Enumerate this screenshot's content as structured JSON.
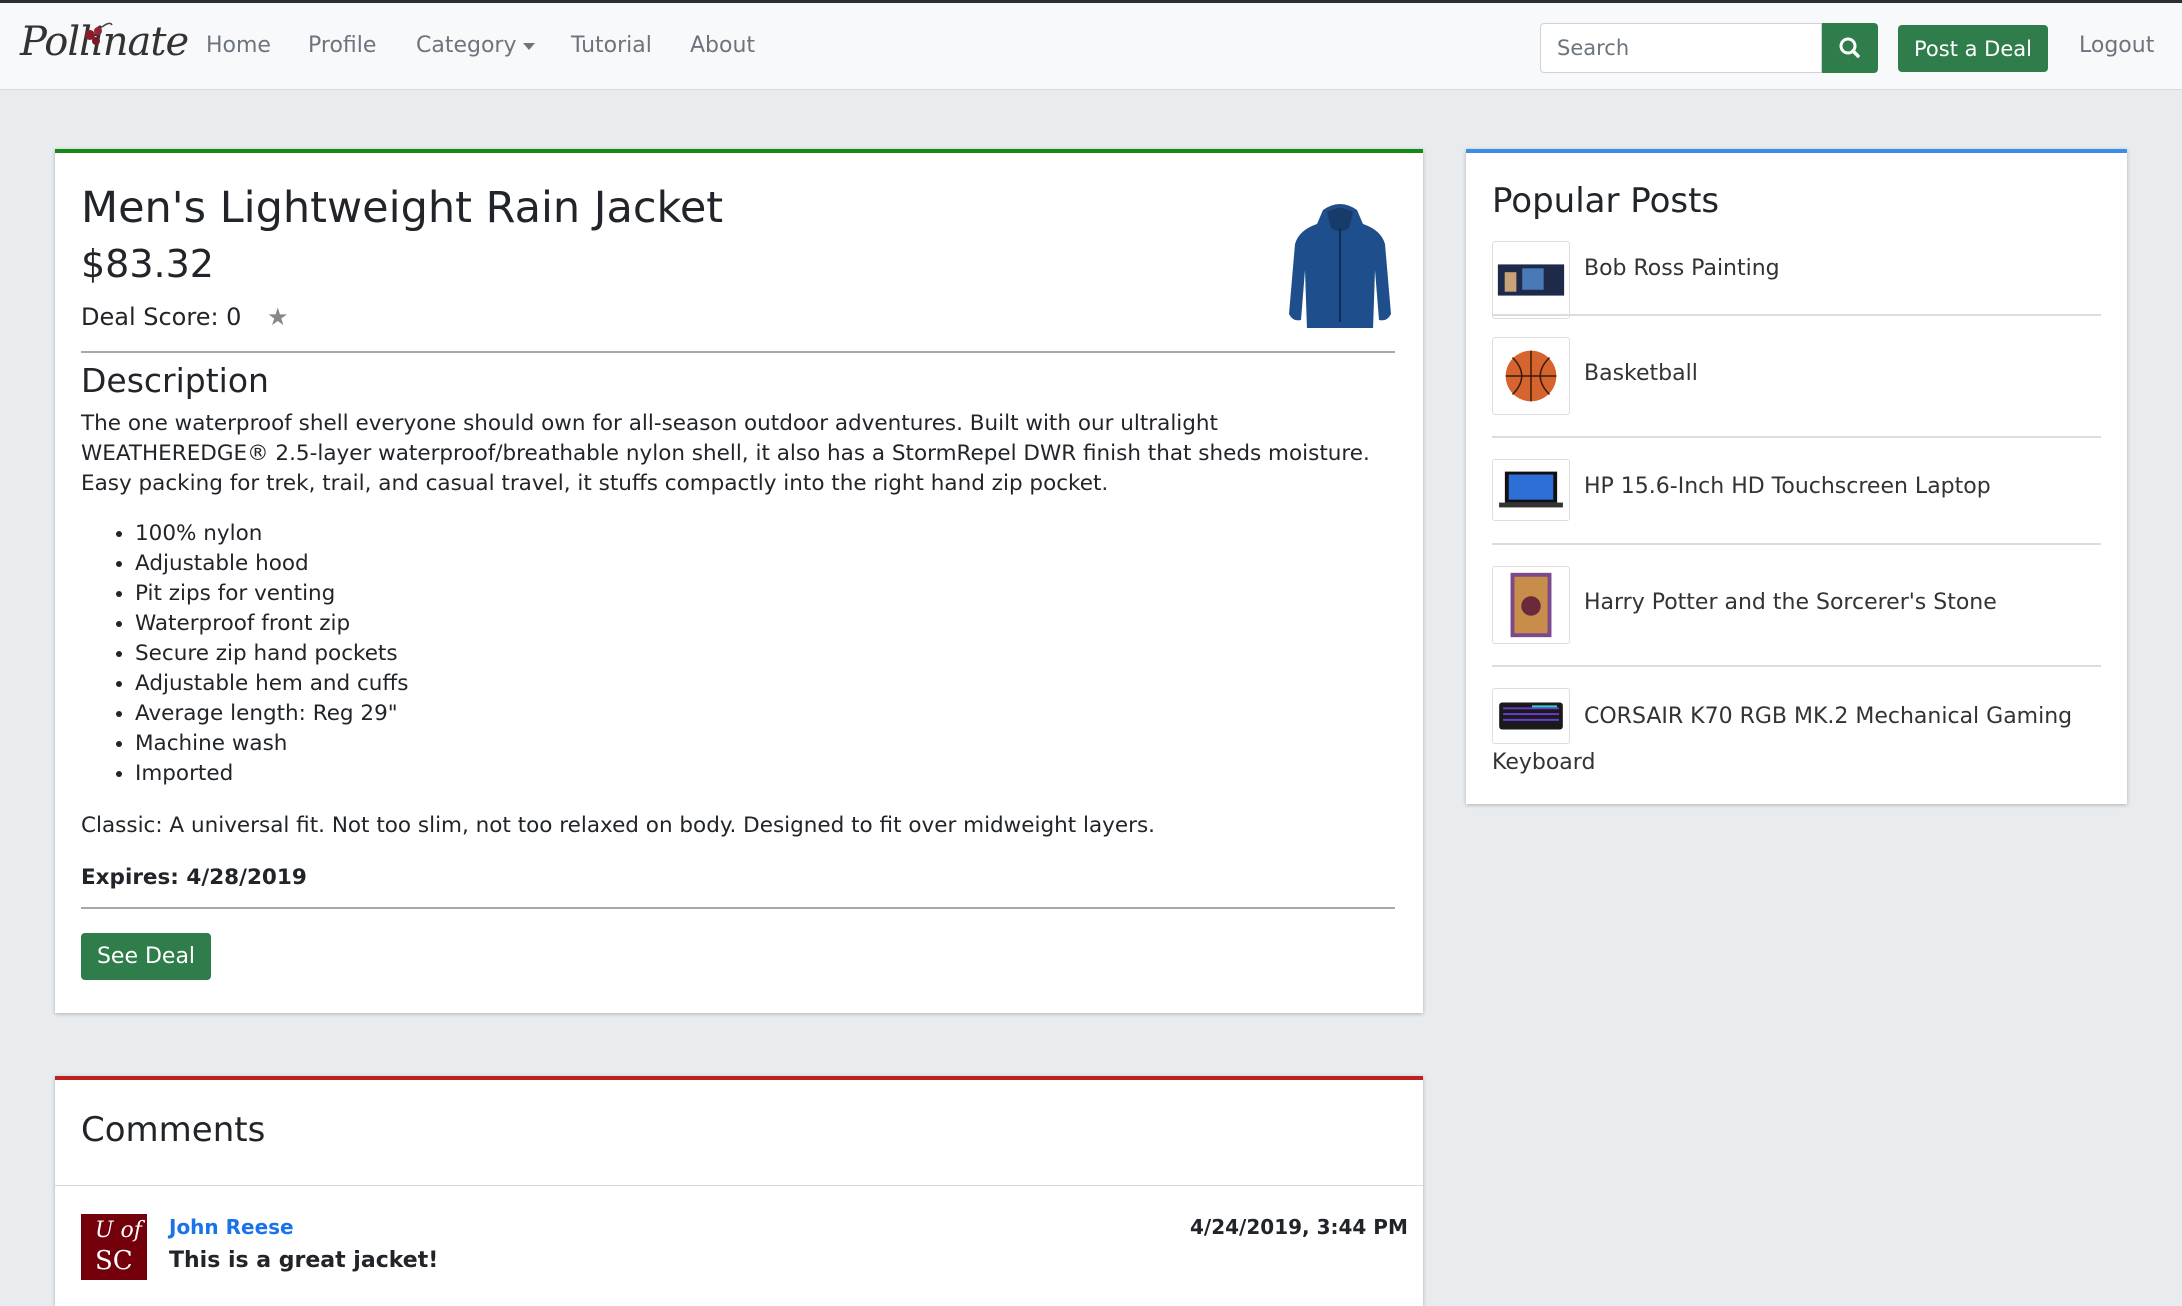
{
  "navbar": {
    "brand": "Pollinate",
    "links": [
      "Home",
      "Profile",
      "Category",
      "Tutorial",
      "About"
    ],
    "search_placeholder": "Search",
    "post_label": "Post a Deal",
    "logout_label": "Logout"
  },
  "deal": {
    "title": "Men's Lightweight Rain Jacket",
    "price": "$83.32",
    "score_label": "Deal Score: 0",
    "description_heading": "Description",
    "description": "The one waterproof shell everyone should own for all-season outdoor adventures. Built with our ultralight WEATHEREDGE® 2.5-layer waterproof/breathable nylon shell, it also has a StormRepel DWR finish that sheds moisture. Easy packing for trek, trail, and casual travel, it stuffs compactly into the right hand zip pocket.",
    "features": [
      "100% nylon",
      "Adjustable hood",
      "Pit zips for venting",
      "Waterproof front zip",
      "Secure zip hand pockets",
      "Adjustable hem and cuffs",
      "Average length: Reg 29\"",
      "Machine wash",
      "Imported"
    ],
    "fit": "Classic: A universal fit. Not too slim, not too relaxed on body. Designed to fit over midweight layers.",
    "expires": "Expires: 4/28/2019",
    "button_label": "See Deal"
  },
  "popular": {
    "heading": "Popular Posts",
    "items": [
      {
        "label": "Bob Ross Painting"
      },
      {
        "label": "Basketball"
      },
      {
        "label": "HP 15.6-Inch HD Touchscreen Laptop"
      },
      {
        "label": "Harry Potter and the Sorcerer's Stone"
      },
      {
        "label_line1": "CORSAIR K70 RGB MK.2 Mechanical Gaming",
        "label_line2": "Keyboard"
      }
    ]
  },
  "comments": {
    "heading": "Comments",
    "items": [
      {
        "avatar_text_1": "U of",
        "avatar_text_2": "SC",
        "user": "John Reese",
        "date": "4/24/2019, 3:44 PM",
        "text": "This is a great jacket!"
      }
    ]
  },
  "colors": {
    "accent_green": "#2e7d4a",
    "deal_border": "#148a14",
    "popular_border": "#3d8bea",
    "comments_border": "#c12020"
  }
}
